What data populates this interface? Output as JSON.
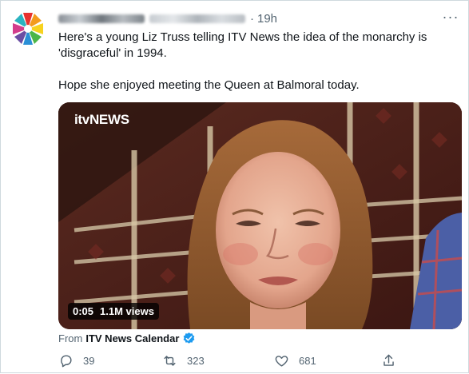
{
  "tweet": {
    "time": "19h",
    "separator": "·",
    "text_line1": "Here's a young Liz Truss telling ITV News the idea of the monarchy is 'disgraceful' in 1994.",
    "text_line2": "Hope she enjoyed meeting the Queen at Balmoral today.",
    "media": {
      "logo_text": "itvNEWS",
      "duration": "0:05",
      "views": "1.1M views"
    },
    "from_prefix": "From",
    "source_name": "ITV News Calendar"
  },
  "actions": {
    "replies": "39",
    "retweets": "323",
    "likes": "681"
  },
  "colors": {
    "text": "#0f1419",
    "secondary": "#536471",
    "verified": "#1d9bf0",
    "border": "#cfd9de"
  }
}
